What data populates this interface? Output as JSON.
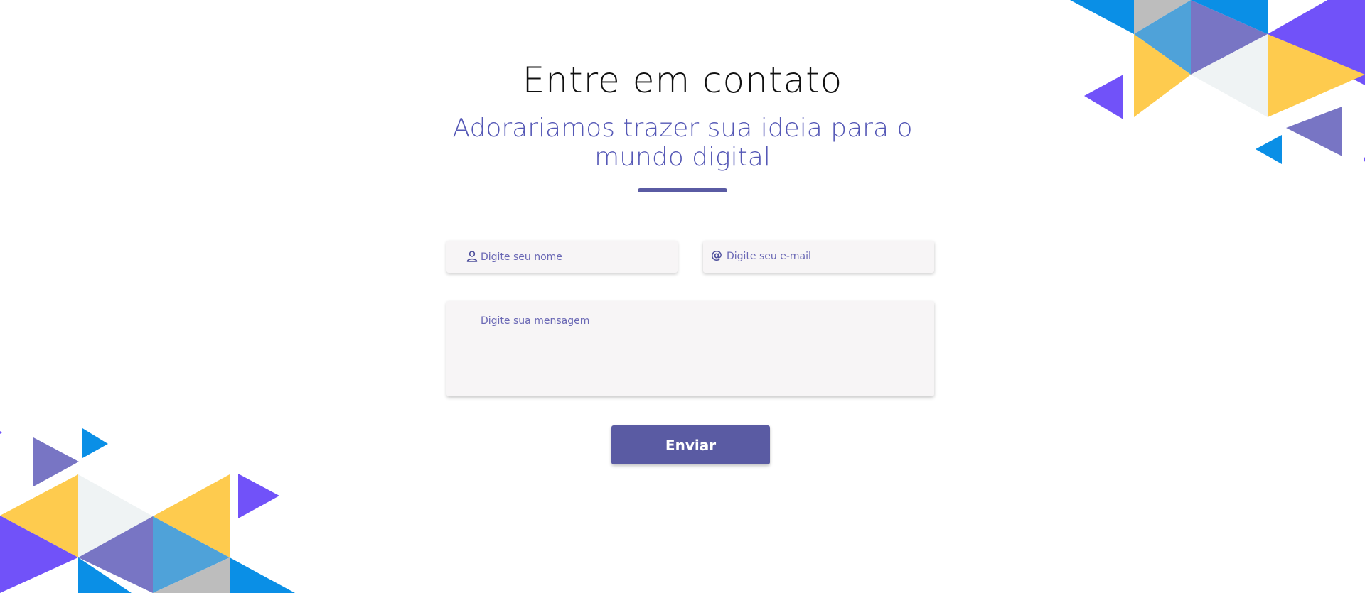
{
  "header": {
    "title": "Entre em contato",
    "subtitle": "Adorariamos trazer sua ideia para o mundo digital"
  },
  "form": {
    "name_placeholder": "Digite seu nome",
    "email_placeholder": "Digite seu e-mail",
    "email_icon_glyph": "@",
    "message_placeholder": "Digite sua mensagem",
    "submit_label": "Enviar"
  },
  "icons": {
    "name_field": "user-icon",
    "email_field": "at-sign-icon"
  },
  "colors": {
    "accent": "#5a5ba3",
    "subtitle": "#5558b6",
    "field_background": "#f7f5f6",
    "decor_yellow": "#fecb4e",
    "decor_blue": "#0a8fe6",
    "decor_lightblue": "#4fa2d9",
    "decor_purple": "#7875c4",
    "decor_violet": "#7152f9",
    "decor_gray": "#bdbdbd",
    "decor_offwhite": "#eff3f4"
  }
}
